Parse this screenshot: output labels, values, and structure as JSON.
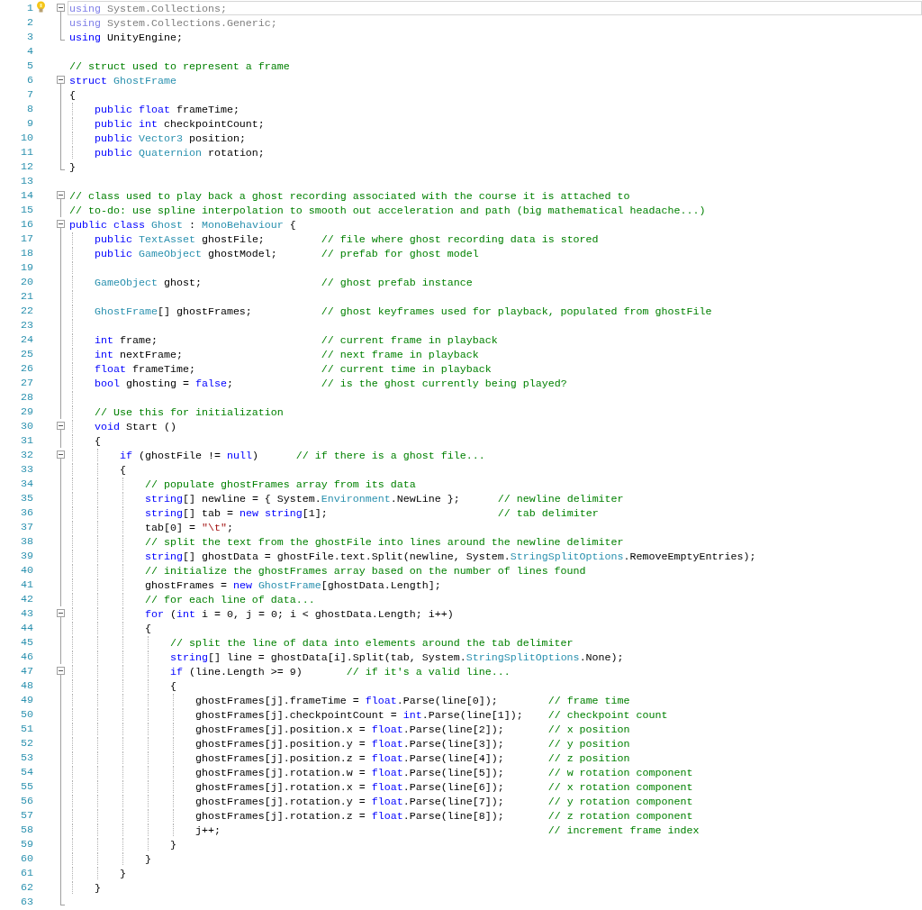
{
  "editor": {
    "lines": [
      {
        "n": "1",
        "collapsible": true,
        "in_region": true,
        "current": true,
        "hint": true,
        "code": [
          {
            "kind": "dimkeyword",
            "text": "using"
          },
          {
            "kind": "dimmed",
            "text": " System.Collections;"
          }
        ]
      },
      {
        "n": "2",
        "collapsible": false,
        "in_region": true,
        "current": false,
        "hint": false,
        "code": [
          {
            "kind": "dimkeyword",
            "text": "using"
          },
          {
            "kind": "dimmed",
            "text": " System.Collections.Generic;"
          }
        ]
      },
      {
        "n": "3",
        "collapsible": false,
        "in_region": true,
        "current": false,
        "hint": false,
        "code": [
          {
            "kind": "keyword",
            "text": "using"
          },
          {
            "kind": "plain",
            "text": " UnityEngine;"
          }
        ]
      },
      {
        "n": "4",
        "collapsible": false,
        "in_region": false,
        "current": false,
        "hint": false
      },
      {
        "n": "5",
        "collapsible": false,
        "in_region": false,
        "current": false,
        "hint": false,
        "code": [
          {
            "kind": "comment",
            "text": "// struct used to represent a frame"
          }
        ]
      },
      {
        "n": "6",
        "collapsible": true,
        "in_region": true,
        "current": false,
        "hint": false,
        "code": [
          {
            "kind": "keyword",
            "text": "struct "
          },
          {
            "kind": "type",
            "text": "GhostFrame"
          }
        ]
      },
      {
        "n": "7",
        "collapsible": false,
        "in_region": true,
        "current": false,
        "hint": false,
        "code": [
          {
            "kind": "plain",
            "text": "{"
          }
        ]
      },
      {
        "n": "8",
        "collapsible": false,
        "in_region": true,
        "current": false,
        "hint": false,
        "code": [
          {
            "kind": "keyword",
            "text": "    public float"
          },
          {
            "kind": "plain",
            "text": " frameTime;"
          }
        ]
      },
      {
        "n": "9",
        "collapsible": false,
        "in_region": true,
        "current": false,
        "hint": false,
        "code": [
          {
            "kind": "keyword",
            "text": "    public int"
          },
          {
            "kind": "plain",
            "text": " checkpointCount;"
          }
        ]
      },
      {
        "n": "10",
        "collapsible": false,
        "in_region": true,
        "current": false,
        "hint": false,
        "code": [
          {
            "kind": "keyword",
            "text": "    public "
          },
          {
            "kind": "type",
            "text": "Vector3"
          },
          {
            "kind": "plain",
            "text": " position;"
          }
        ]
      },
      {
        "n": "11",
        "collapsible": false,
        "in_region": true,
        "current": false,
        "hint": false,
        "code": [
          {
            "kind": "keyword",
            "text": "    public "
          },
          {
            "kind": "type",
            "text": "Quaternion"
          },
          {
            "kind": "plain",
            "text": " rotation;"
          }
        ]
      },
      {
        "n": "12",
        "collapsible": false,
        "in_region": true,
        "current": false,
        "hint": false,
        "code": [
          {
            "kind": "plain",
            "text": "}"
          }
        ]
      },
      {
        "n": "13",
        "collapsible": false,
        "in_region": false,
        "current": false,
        "hint": false
      },
      {
        "n": "14",
        "collapsible": true,
        "in_region": true,
        "current": false,
        "hint": false,
        "code": [
          {
            "kind": "comment",
            "text": "// class used to play back a ghost recording associated with the course it is attached to"
          }
        ]
      },
      {
        "n": "15",
        "collapsible": false,
        "in_region": true,
        "current": false,
        "hint": false,
        "code": [
          {
            "kind": "comment",
            "text": "// to-do: use spline interpolation to smooth out acceleration and path (big mathematical headache...)"
          }
        ]
      },
      {
        "n": "16",
        "collapsible": true,
        "in_region": true,
        "current": false,
        "hint": false,
        "code": [
          {
            "kind": "keyword",
            "text": "public class "
          },
          {
            "kind": "type",
            "text": "Ghost"
          },
          {
            "kind": "plain",
            "text": " : "
          },
          {
            "kind": "type",
            "text": "MonoBehaviour"
          },
          {
            "kind": "plain",
            "text": " {"
          }
        ]
      },
      {
        "n": "17",
        "collapsible": false,
        "in_region": true,
        "current": false,
        "hint": false,
        "code": [
          {
            "kind": "keyword",
            "text": "    public "
          },
          {
            "kind": "type",
            "text": "TextAsset"
          },
          {
            "kind": "plain",
            "text": " ghostFile;         "
          },
          {
            "kind": "comment",
            "text": "// file where ghost recording data is stored"
          }
        ]
      },
      {
        "n": "18",
        "collapsible": false,
        "in_region": true,
        "current": false,
        "hint": false,
        "code": [
          {
            "kind": "keyword",
            "text": "    public "
          },
          {
            "kind": "type",
            "text": "GameObject"
          },
          {
            "kind": "plain",
            "text": " ghostModel;       "
          },
          {
            "kind": "comment",
            "text": "// prefab for ghost model"
          }
        ]
      },
      {
        "n": "19",
        "collapsible": false,
        "in_region": true,
        "current": false,
        "hint": false
      },
      {
        "n": "20",
        "collapsible": false,
        "in_region": true,
        "current": false,
        "hint": false,
        "code": [
          {
            "kind": "type",
            "text": "    GameObject"
          },
          {
            "kind": "plain",
            "text": " ghost;                   "
          },
          {
            "kind": "comment",
            "text": "// ghost prefab instance"
          }
        ]
      },
      {
        "n": "21",
        "collapsible": false,
        "in_region": true,
        "current": false,
        "hint": false
      },
      {
        "n": "22",
        "collapsible": false,
        "in_region": true,
        "current": false,
        "hint": false,
        "code": [
          {
            "kind": "type",
            "text": "    GhostFrame"
          },
          {
            "kind": "plain",
            "text": "[] ghostFrames;           "
          },
          {
            "kind": "comment",
            "text": "// ghost keyframes used for playback, populated from ghostFile"
          }
        ]
      },
      {
        "n": "23",
        "collapsible": false,
        "in_region": true,
        "current": false,
        "hint": false
      },
      {
        "n": "24",
        "collapsible": false,
        "in_region": true,
        "current": false,
        "hint": false,
        "code": [
          {
            "kind": "keyword",
            "text": "    int"
          },
          {
            "kind": "plain",
            "text": " frame;                          "
          },
          {
            "kind": "comment",
            "text": "// current frame in playback"
          }
        ]
      },
      {
        "n": "25",
        "collapsible": false,
        "in_region": true,
        "current": false,
        "hint": false,
        "code": [
          {
            "kind": "keyword",
            "text": "    int"
          },
          {
            "kind": "plain",
            "text": " nextFrame;                      "
          },
          {
            "kind": "comment",
            "text": "// next frame in playback"
          }
        ]
      },
      {
        "n": "26",
        "collapsible": false,
        "in_region": true,
        "current": false,
        "hint": false,
        "code": [
          {
            "kind": "keyword",
            "text": "    float"
          },
          {
            "kind": "plain",
            "text": " frameTime;                    "
          },
          {
            "kind": "comment",
            "text": "// current time in playback"
          }
        ]
      },
      {
        "n": "27",
        "collapsible": false,
        "in_region": true,
        "current": false,
        "hint": false,
        "code": [
          {
            "kind": "keyword",
            "text": "    bool"
          },
          {
            "kind": "plain",
            "text": " ghosting = "
          },
          {
            "kind": "keyword",
            "text": "false"
          },
          {
            "kind": "plain",
            "text": ";              "
          },
          {
            "kind": "comment",
            "text": "// is the ghost currently being played?"
          }
        ]
      },
      {
        "n": "28",
        "collapsible": false,
        "in_region": true,
        "current": false,
        "hint": false
      },
      {
        "n": "29",
        "collapsible": false,
        "in_region": true,
        "current": false,
        "hint": false,
        "code": [
          {
            "kind": "comment",
            "text": "    // Use this for initialization"
          }
        ]
      },
      {
        "n": "30",
        "collapsible": true,
        "in_region": true,
        "current": false,
        "hint": false,
        "code": [
          {
            "kind": "keyword",
            "text": "    void"
          },
          {
            "kind": "plain",
            "text": " Start ()"
          }
        ]
      },
      {
        "n": "31",
        "collapsible": false,
        "in_region": true,
        "current": false,
        "hint": false,
        "code": [
          {
            "kind": "plain",
            "text": "    {"
          }
        ]
      },
      {
        "n": "32",
        "collapsible": true,
        "in_region": true,
        "current": false,
        "hint": false,
        "code": [
          {
            "kind": "keyword",
            "text": "        if"
          },
          {
            "kind": "plain",
            "text": " (ghostFile != "
          },
          {
            "kind": "keyword",
            "text": "null"
          },
          {
            "kind": "plain",
            "text": ")      "
          },
          {
            "kind": "comment",
            "text": "// if there is a ghost file..."
          }
        ]
      },
      {
        "n": "33",
        "collapsible": false,
        "in_region": true,
        "current": false,
        "hint": false,
        "code": [
          {
            "kind": "plain",
            "text": "        {"
          }
        ]
      },
      {
        "n": "34",
        "collapsible": false,
        "in_region": true,
        "current": false,
        "hint": false,
        "code": [
          {
            "kind": "comment",
            "text": "            // populate ghostFrames array from its data"
          }
        ]
      },
      {
        "n": "35",
        "collapsible": false,
        "in_region": true,
        "current": false,
        "hint": false,
        "code": [
          {
            "kind": "keyword",
            "text": "            string"
          },
          {
            "kind": "plain",
            "text": "[] newline = { System."
          },
          {
            "kind": "type",
            "text": "Environment"
          },
          {
            "kind": "plain",
            "text": ".NewLine };      "
          },
          {
            "kind": "comment",
            "text": "// newline delimiter"
          }
        ]
      },
      {
        "n": "36",
        "collapsible": false,
        "in_region": true,
        "current": false,
        "hint": false,
        "code": [
          {
            "kind": "keyword",
            "text": "            string"
          },
          {
            "kind": "plain",
            "text": "[] tab = "
          },
          {
            "kind": "keyword",
            "text": "new string"
          },
          {
            "kind": "plain",
            "text": "[1];                           "
          },
          {
            "kind": "comment",
            "text": "// tab delimiter"
          }
        ]
      },
      {
        "n": "37",
        "collapsible": false,
        "in_region": true,
        "current": false,
        "hint": false,
        "code": [
          {
            "kind": "plain",
            "text": "            tab[0] = "
          },
          {
            "kind": "string",
            "text": "\"\\t\""
          },
          {
            "kind": "plain",
            "text": ";"
          }
        ]
      },
      {
        "n": "38",
        "collapsible": false,
        "in_region": true,
        "current": false,
        "hint": false,
        "code": [
          {
            "kind": "comment",
            "text": "            // split the text from the ghostFile into lines around the newline delimiter"
          }
        ]
      },
      {
        "n": "39",
        "collapsible": false,
        "in_region": true,
        "current": false,
        "hint": false,
        "code": [
          {
            "kind": "keyword",
            "text": "            string"
          },
          {
            "kind": "plain",
            "text": "[] ghostData = ghostFile.text.Split(newline, System."
          },
          {
            "kind": "type",
            "text": "StringSplitOptions"
          },
          {
            "kind": "plain",
            "text": ".RemoveEmptyEntries);"
          }
        ]
      },
      {
        "n": "40",
        "collapsible": false,
        "in_region": true,
        "current": false,
        "hint": false,
        "code": [
          {
            "kind": "comment",
            "text": "            // initialize the ghostFrames array based on the number of lines found"
          }
        ]
      },
      {
        "n": "41",
        "collapsible": false,
        "in_region": true,
        "current": false,
        "hint": false,
        "code": [
          {
            "kind": "plain",
            "text": "            ghostFrames = "
          },
          {
            "kind": "keyword",
            "text": "new "
          },
          {
            "kind": "type",
            "text": "GhostFrame"
          },
          {
            "kind": "plain",
            "text": "[ghostData.Length];"
          }
        ]
      },
      {
        "n": "42",
        "collapsible": false,
        "in_region": true,
        "current": false,
        "hint": false,
        "code": [
          {
            "kind": "comment",
            "text": "            // for each line of data..."
          }
        ]
      },
      {
        "n": "43",
        "collapsible": true,
        "in_region": true,
        "current": false,
        "hint": false,
        "code": [
          {
            "kind": "keyword",
            "text": "            for"
          },
          {
            "kind": "plain",
            "text": " ("
          },
          {
            "kind": "keyword",
            "text": "int"
          },
          {
            "kind": "plain",
            "text": " i = 0, j = 0; i < ghostData.Length; i++)"
          }
        ]
      },
      {
        "n": "44",
        "collapsible": false,
        "in_region": true,
        "current": false,
        "hint": false,
        "code": [
          {
            "kind": "plain",
            "text": "            {"
          }
        ]
      },
      {
        "n": "45",
        "collapsible": false,
        "in_region": true,
        "current": false,
        "hint": false,
        "code": [
          {
            "kind": "comment",
            "text": "                // split the line of data into elements around the tab delimiter"
          }
        ]
      },
      {
        "n": "46",
        "collapsible": false,
        "in_region": true,
        "current": false,
        "hint": false,
        "code": [
          {
            "kind": "keyword",
            "text": "                string"
          },
          {
            "kind": "plain",
            "text": "[] line = ghostData[i].Split(tab, System."
          },
          {
            "kind": "type",
            "text": "StringSplitOptions"
          },
          {
            "kind": "plain",
            "text": ".None);"
          }
        ]
      },
      {
        "n": "47",
        "collapsible": true,
        "in_region": true,
        "current": false,
        "hint": false,
        "code": [
          {
            "kind": "keyword",
            "text": "                if"
          },
          {
            "kind": "plain",
            "text": " (line.Length >= 9)       "
          },
          {
            "kind": "comment",
            "text": "// if it's a valid line..."
          }
        ]
      },
      {
        "n": "48",
        "collapsible": false,
        "in_region": true,
        "current": false,
        "hint": false,
        "code": [
          {
            "kind": "plain",
            "text": "                {"
          }
        ]
      },
      {
        "n": "49",
        "collapsible": false,
        "in_region": true,
        "current": false,
        "hint": false,
        "code": [
          {
            "kind": "plain",
            "text": "                    ghostFrames[j].frameTime = "
          },
          {
            "kind": "keyword",
            "text": "float"
          },
          {
            "kind": "plain",
            "text": ".Parse(line[0]);        "
          },
          {
            "kind": "comment",
            "text": "// frame time"
          }
        ]
      },
      {
        "n": "50",
        "collapsible": false,
        "in_region": true,
        "current": false,
        "hint": false,
        "code": [
          {
            "kind": "plain",
            "text": "                    ghostFrames[j].checkpointCount = "
          },
          {
            "kind": "keyword",
            "text": "int"
          },
          {
            "kind": "plain",
            "text": ".Parse(line[1]);    "
          },
          {
            "kind": "comment",
            "text": "// checkpoint count"
          }
        ]
      },
      {
        "n": "51",
        "collapsible": false,
        "in_region": true,
        "current": false,
        "hint": false,
        "code": [
          {
            "kind": "plain",
            "text": "                    ghostFrames[j].position.x = "
          },
          {
            "kind": "keyword",
            "text": "float"
          },
          {
            "kind": "plain",
            "text": ".Parse(line[2]);       "
          },
          {
            "kind": "comment",
            "text": "// x position"
          }
        ]
      },
      {
        "n": "52",
        "collapsible": false,
        "in_region": true,
        "current": false,
        "hint": false,
        "code": [
          {
            "kind": "plain",
            "text": "                    ghostFrames[j].position.y = "
          },
          {
            "kind": "keyword",
            "text": "float"
          },
          {
            "kind": "plain",
            "text": ".Parse(line[3]);       "
          },
          {
            "kind": "comment",
            "text": "// y position"
          }
        ]
      },
      {
        "n": "53",
        "collapsible": false,
        "in_region": true,
        "current": false,
        "hint": false,
        "code": [
          {
            "kind": "plain",
            "text": "                    ghostFrames[j].position.z = "
          },
          {
            "kind": "keyword",
            "text": "float"
          },
          {
            "kind": "plain",
            "text": ".Parse(line[4]);       "
          },
          {
            "kind": "comment",
            "text": "// z position"
          }
        ]
      },
      {
        "n": "54",
        "collapsible": false,
        "in_region": true,
        "current": false,
        "hint": false,
        "code": [
          {
            "kind": "plain",
            "text": "                    ghostFrames[j].rotation.w = "
          },
          {
            "kind": "keyword",
            "text": "float"
          },
          {
            "kind": "plain",
            "text": ".Parse(line[5]);       "
          },
          {
            "kind": "comment",
            "text": "// w rotation component"
          }
        ]
      },
      {
        "n": "55",
        "collapsible": false,
        "in_region": true,
        "current": false,
        "hint": false,
        "code": [
          {
            "kind": "plain",
            "text": "                    ghostFrames[j].rotation.x = "
          },
          {
            "kind": "keyword",
            "text": "float"
          },
          {
            "kind": "plain",
            "text": ".Parse(line[6]);       "
          },
          {
            "kind": "comment",
            "text": "// x rotation component"
          }
        ]
      },
      {
        "n": "56",
        "collapsible": false,
        "in_region": true,
        "current": false,
        "hint": false,
        "code": [
          {
            "kind": "plain",
            "text": "                    ghostFrames[j].rotation.y = "
          },
          {
            "kind": "keyword",
            "text": "float"
          },
          {
            "kind": "plain",
            "text": ".Parse(line[7]);       "
          },
          {
            "kind": "comment",
            "text": "// y rotation component"
          }
        ]
      },
      {
        "n": "57",
        "collapsible": false,
        "in_region": true,
        "current": false,
        "hint": false,
        "code": [
          {
            "kind": "plain",
            "text": "                    ghostFrames[j].rotation.z = "
          },
          {
            "kind": "keyword",
            "text": "float"
          },
          {
            "kind": "plain",
            "text": ".Parse(line[8]);       "
          },
          {
            "kind": "comment",
            "text": "// z rotation component"
          }
        ]
      },
      {
        "n": "58",
        "collapsible": false,
        "in_region": true,
        "current": false,
        "hint": false,
        "code": [
          {
            "kind": "plain",
            "text": "                    j++;                                                    "
          },
          {
            "kind": "comment",
            "text": "// increment frame index"
          }
        ]
      },
      {
        "n": "59",
        "collapsible": false,
        "in_region": true,
        "current": false,
        "hint": false,
        "code": [
          {
            "kind": "plain",
            "text": "                }"
          }
        ]
      },
      {
        "n": "60",
        "collapsible": false,
        "in_region": true,
        "current": false,
        "hint": false,
        "code": [
          {
            "kind": "plain",
            "text": "            }"
          }
        ]
      },
      {
        "n": "61",
        "collapsible": false,
        "in_region": true,
        "current": false,
        "hint": false,
        "code": [
          {
            "kind": "plain",
            "text": "        }"
          }
        ]
      },
      {
        "n": "62",
        "collapsible": false,
        "in_region": true,
        "current": false,
        "hint": false,
        "code": [
          {
            "kind": "plain",
            "text": "    }"
          }
        ]
      },
      {
        "n": "63",
        "collapsible": false,
        "in_region": true,
        "current": false,
        "hint": false
      }
    ]
  }
}
